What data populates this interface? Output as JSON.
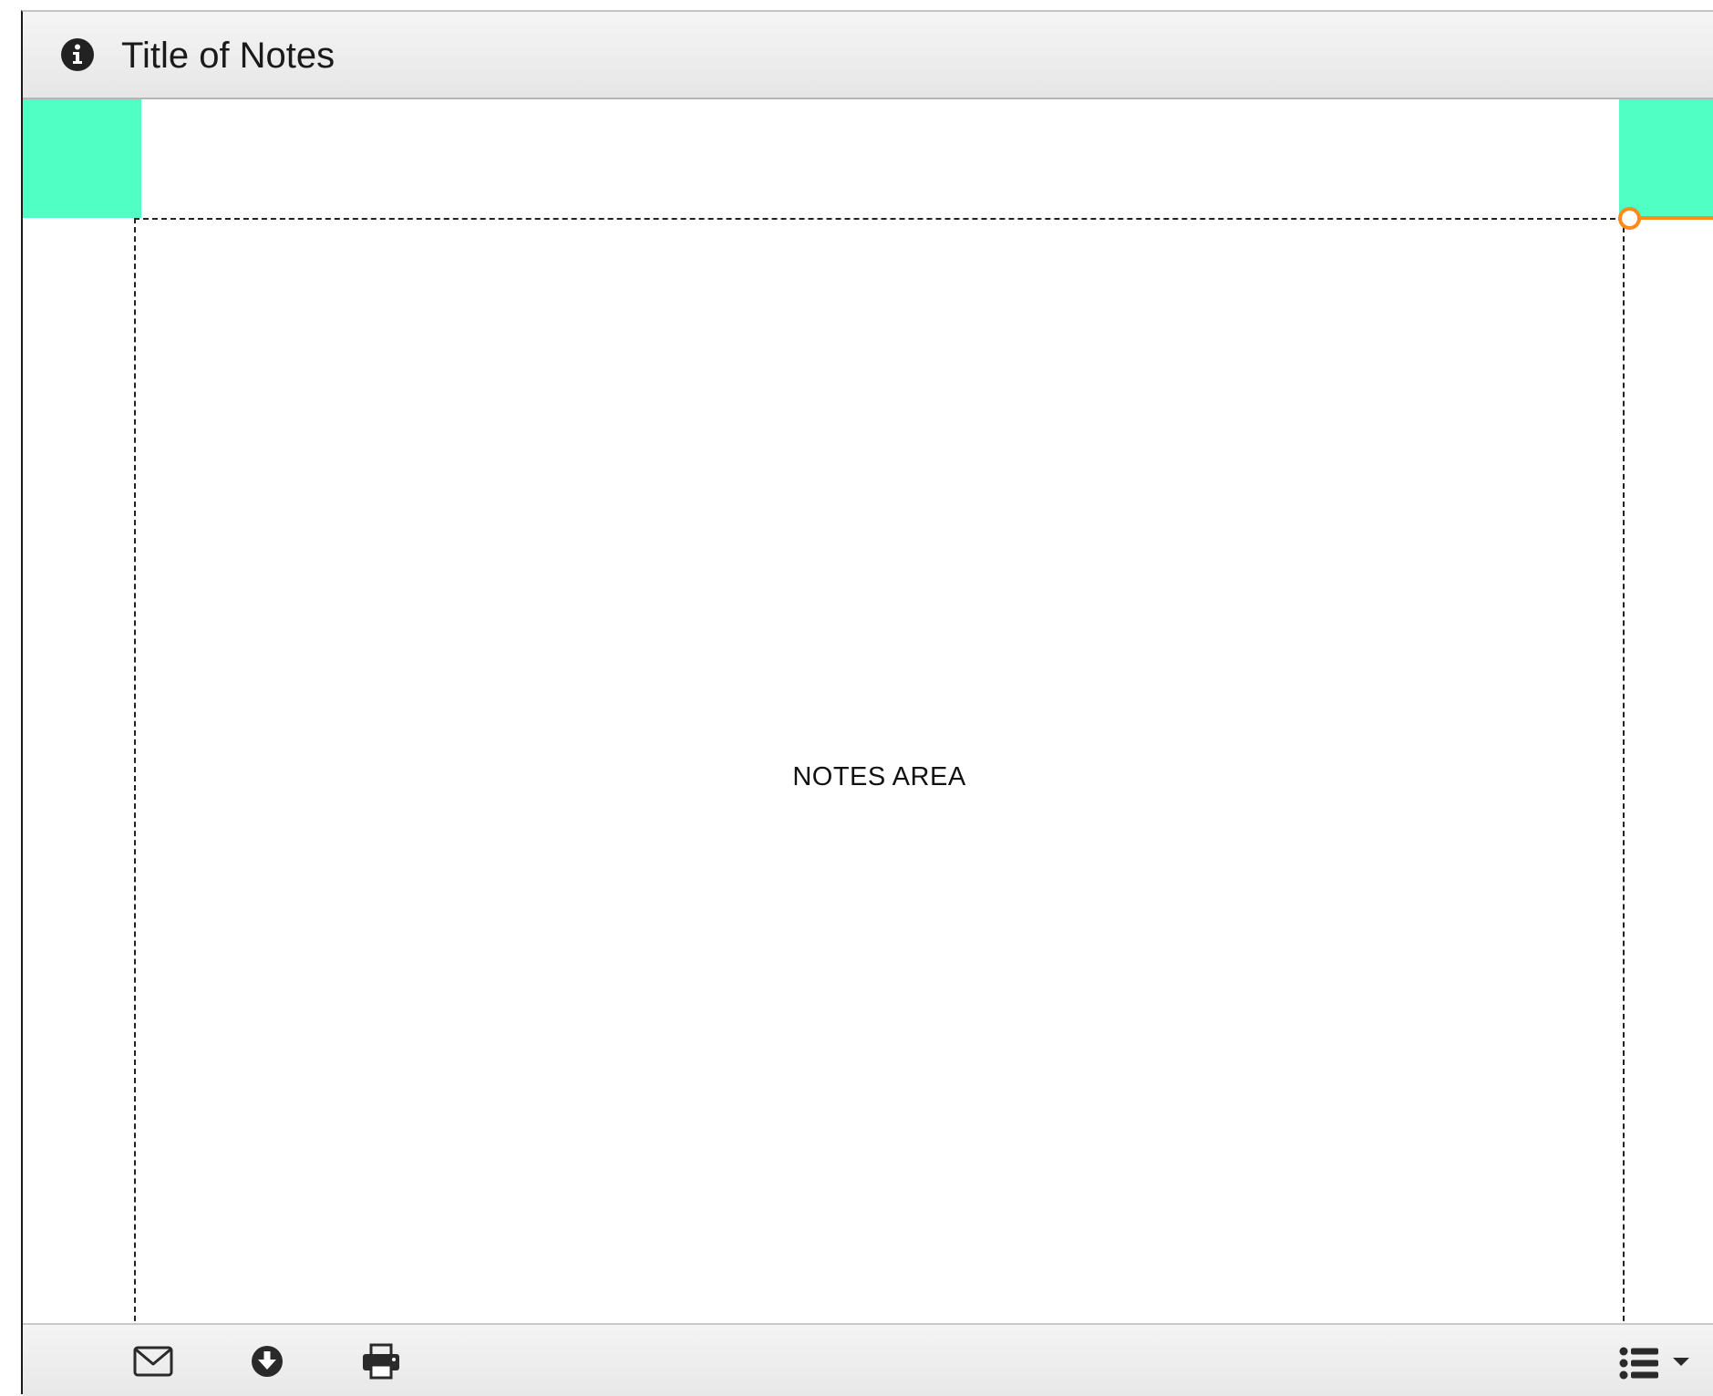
{
  "header": {
    "title": "Title of Notes",
    "icon": "info-icon"
  },
  "notes": {
    "label": "NOTES AREA"
  },
  "footer": {
    "tools": [
      {
        "icon": "envelope-icon"
      },
      {
        "icon": "download-icon"
      },
      {
        "icon": "printer-icon"
      }
    ],
    "menu_icon": "list-icon"
  },
  "colors": {
    "margin_accent": "#50ffc3",
    "handle_accent": "#ff8a1c",
    "header_bg": "#ececec"
  }
}
